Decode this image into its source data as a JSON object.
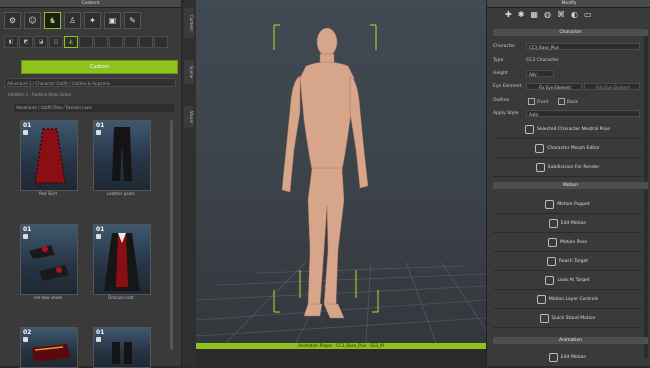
{
  "content_panel": {
    "title": "Content",
    "apply_button": "Custom",
    "search_text": "Adventure 1 / Character Outfit / Clothes & Apparels",
    "breadcrumb": "Addition 1 · Fashion Style Dress",
    "path_field": "Adventure / Outfit Files / Fashion Lace",
    "items": [
      {
        "num": "01",
        "label": "Red Skirt"
      },
      {
        "num": "01",
        "label": "Leather pants"
      },
      {
        "num": "01",
        "label": "red bow shoes"
      },
      {
        "num": "01",
        "label": "Dracula coat"
      },
      {
        "num": "02",
        "label": ""
      },
      {
        "num": "01",
        "label": ""
      }
    ]
  },
  "side_tabs": [
    "Content",
    "Scene",
    "Visual"
  ],
  "viewport": {
    "status": "Animation Player : CC3_Base_Plus · SG3_M",
    "accent": "#8dc21f"
  },
  "modify_panel": {
    "title": "Modify",
    "character_section": "Character",
    "fields": {
      "character_label": "Character",
      "character_value": "CC3_Base_Plus",
      "type_label": "Type",
      "type_value": "CC3 Character",
      "height_label": "Height",
      "height_value": "Adv",
      "eye_label": "Eye Element",
      "eye_value": "Fix Eye Element",
      "eye_btn": "Add Eye Element",
      "outline_label": "Outline",
      "outline_a": "Front",
      "outline_b": "Back",
      "apply_label": "Apply Style",
      "apply_value": "Auto"
    },
    "character_actions": [
      "Selected Character Neutral Pose",
      "Character Morph Editor",
      "Subdivision For Render"
    ],
    "motion_section": "Motion",
    "motion_actions": [
      "Motion Puppet",
      "Edit Motion",
      "Motion Pose",
      "Reach Target",
      "Look At Target",
      "Motion Layer Controls",
      "Quick Stand Motion"
    ],
    "animation_section": "Animation",
    "animation_actions": [
      "Edit Motion"
    ]
  }
}
